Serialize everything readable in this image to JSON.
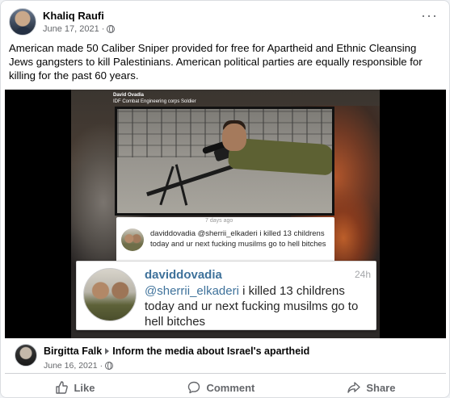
{
  "post": {
    "author": "Khaliq Raufi",
    "date": "June 17, 2021",
    "date_sep": "·",
    "more": "···",
    "text": "American made 50 Caliber Sniper provided for free for Apartheid and Ethnic Cleansing Jews gangsters to kill Palestinians. American political parties are equally responsible for killing for the past 60 years."
  },
  "image": {
    "caption_name": "David Ovadia",
    "caption_unit": "IDF Combat Engineering corps Soldier",
    "small_comment": {
      "time_partial": "7 days ago",
      "user": "daviddovadia",
      "text": "daviddovadia @sherrii_elkaderi i killed 13 childrens today and ur next fucking musilms go to hell bitches"
    },
    "big_comment": {
      "user": "daviddovadia",
      "time": "24h",
      "mention": "@sherrii_elkaderi",
      "text": " i killed 13 childrens today and ur next fucking musilms go to hell bitches"
    }
  },
  "shared": {
    "name": "Birgitta Falk",
    "group": "Inform the media about Israel's apartheid",
    "date": "June 16, 2021",
    "date_sep": "·"
  },
  "actions": {
    "like": "Like",
    "comment": "Comment",
    "share": "Share"
  },
  "icons": [
    "globe-icon",
    "more-icon",
    "like-icon",
    "comment-icon",
    "share-icon",
    "arrow-icon"
  ]
}
